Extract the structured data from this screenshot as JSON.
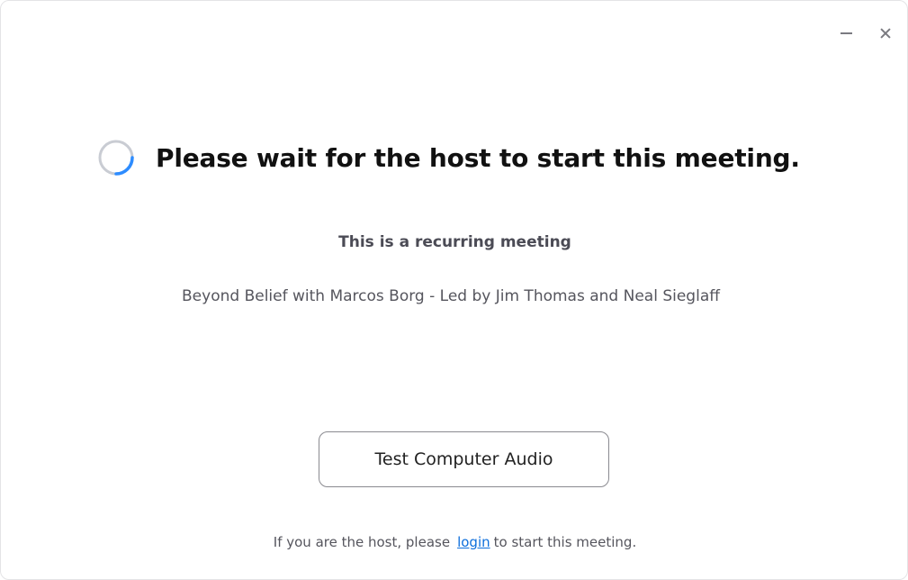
{
  "window": {
    "controls": {
      "minimize_icon": "minimize-icon",
      "close_icon": "close-icon"
    }
  },
  "main": {
    "headline": "Please wait for the host to start this meeting.",
    "spinner_icon": "loading-spinner-icon",
    "recurring_label": "This is a recurring meeting",
    "meeting_topic": "Beyond Belief with Marcos Borg - Led by Jim Thomas and Neal Sieglaff",
    "test_audio_button": "Test Computer Audio"
  },
  "footer": {
    "prefix": "If you are the host, please",
    "login_link": "login",
    "suffix": "to start this meeting."
  },
  "colors": {
    "link": "#0e6fdc",
    "spinner_accent": "#2d8cff",
    "spinner_track": "#c9ccd3"
  }
}
